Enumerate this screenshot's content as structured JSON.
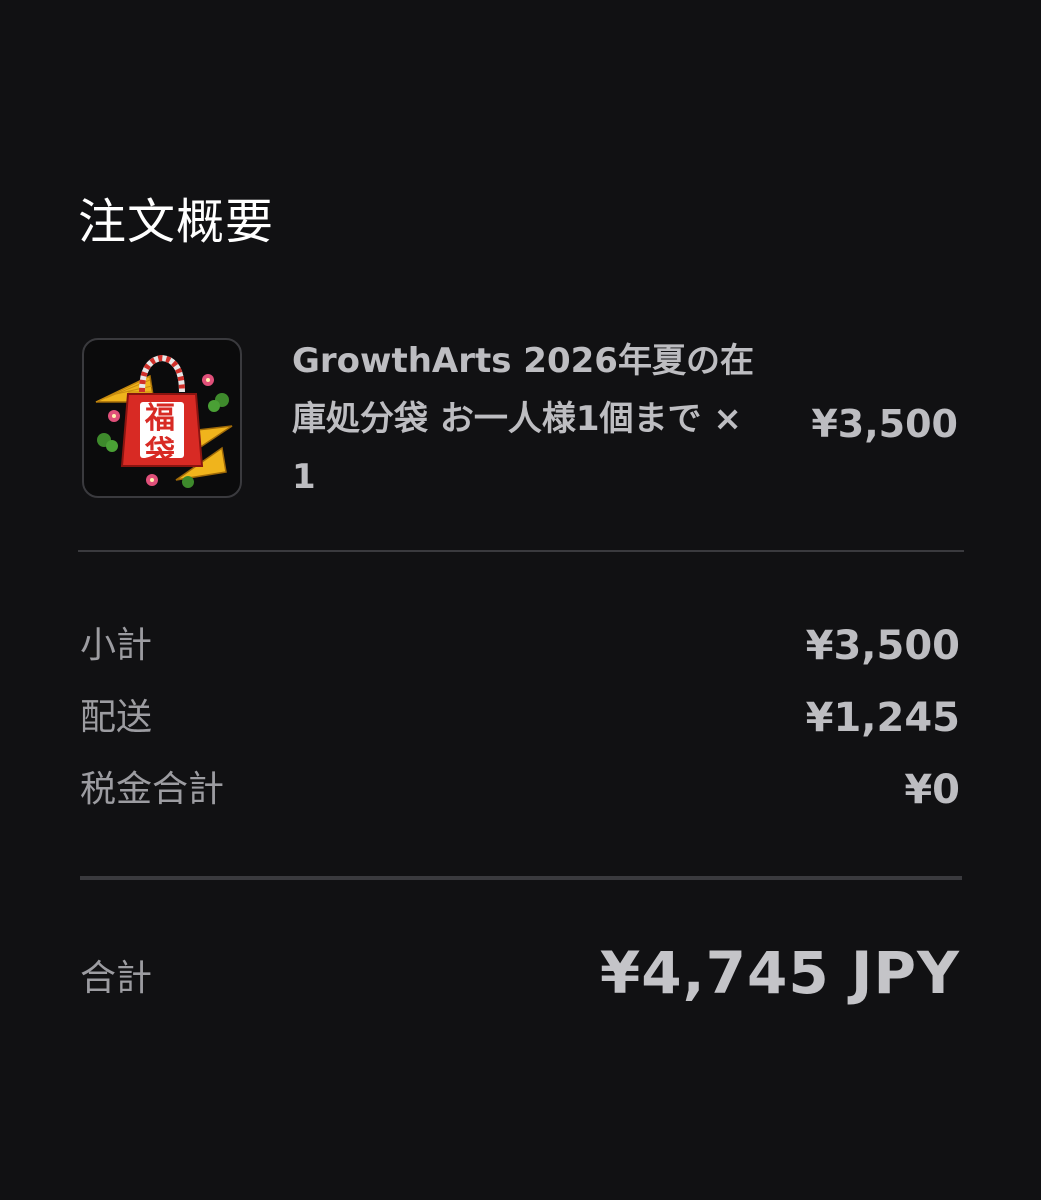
{
  "header": {
    "title": "注文概要"
  },
  "item": {
    "icon": "lucky-bag-icon",
    "image_text": "福袋",
    "name": "GrowthArts 2026年夏の在庫処分袋 お一人様1個まで × 1",
    "price": "¥3,500"
  },
  "summary": {
    "subtotal_label": "小計",
    "subtotal_value": "¥3,500",
    "shipping_label": "配送",
    "shipping_value": "¥1,245",
    "tax_label": "税金合計",
    "tax_value": "¥0"
  },
  "total": {
    "label": "合計",
    "value": "¥4,745 JPY"
  },
  "colors": {
    "background": "#111113",
    "divider": "#3a3a3e",
    "title": "#ffffff",
    "text": "#bdbdc1"
  }
}
